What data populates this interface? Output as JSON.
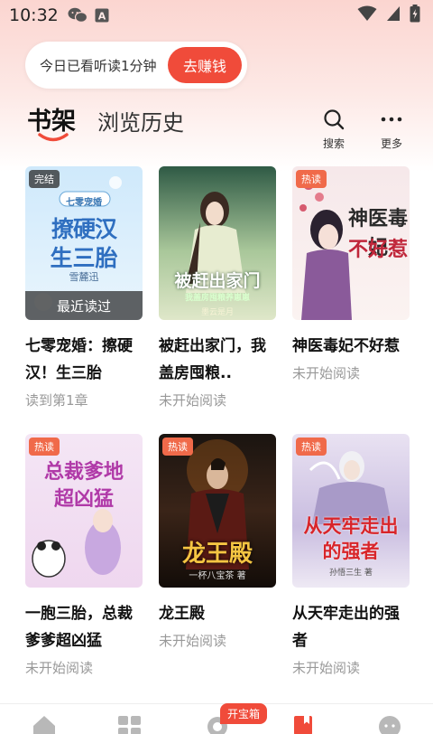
{
  "status_bar": {
    "time": "10:32",
    "wechat_icon": "wechat-icon",
    "keyboard_icon": "a-icon"
  },
  "banner": {
    "text": "今日已看听读1分钟",
    "button_label": "去赚钱",
    "accent": "#f04b3a"
  },
  "tabs": {
    "bookshelf": "书架",
    "history": "浏览历史"
  },
  "header_actions": {
    "search_label": "搜索",
    "more_label": "更多"
  },
  "books": [
    {
      "title": "七零宠婚：擦硬汉！生三胎",
      "progress": "读到第1章",
      "badge": "完结",
      "overlay": "最近读过",
      "cover_lines": [
        "七零宠婚",
        "撩硬汉",
        "生三胎"
      ],
      "cover_author": "雪麓迅"
    },
    {
      "title": "被赶出家门，我盖房囤粮..",
      "progress": "未开始阅读",
      "cover_lines": [
        "被赶出家门",
        "我盖房囤粮养崽崽"
      ],
      "cover_author": "墨云是月"
    },
    {
      "title": "神医毒妃不好惹",
      "progress": "未开始阅读",
      "badge": "热读",
      "cover_lines": [
        "神医毒妃",
        "不好惹"
      ]
    },
    {
      "title": "一胞三胎，总裁爹爹超凶猛",
      "progress": "未开始阅读",
      "badge": "热读",
      "cover_lines": [
        "总裁爹地",
        "超凶猛"
      ]
    },
    {
      "title": "龙王殿",
      "progress": "未开始阅读",
      "badge": "热读",
      "cover_lines": [
        "龙王殿"
      ],
      "cover_author": "一杯八宝茶 著"
    },
    {
      "title": "从天牢走出的强者",
      "progress": "未开始阅读",
      "badge": "热读",
      "cover_lines": [
        "从天牢走出",
        "的强者"
      ],
      "cover_author": "孙悟三生 著"
    }
  ],
  "bottom_nav": {
    "treasure_badge": "开宝箱",
    "items": [
      "home-icon",
      "category-icon",
      "welfare-icon",
      "bookshelf-icon",
      "profile-icon"
    ]
  }
}
